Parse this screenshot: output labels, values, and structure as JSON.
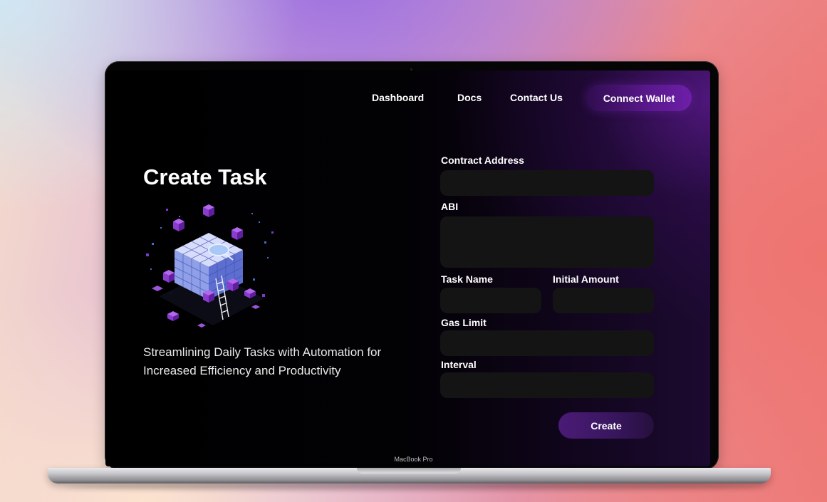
{
  "nav": {
    "dashboard": "Dashboard",
    "docs": "Docs",
    "contact": "Contact Us",
    "connect_wallet": "Connect Wallet"
  },
  "hero": {
    "title": "Create Task",
    "tagline": "Streamlining Daily Tasks with Automation for Increased Efficiency and Productivity"
  },
  "form": {
    "contract_address": {
      "label": "Contract Address",
      "value": ""
    },
    "abi": {
      "label": "ABI",
      "value": ""
    },
    "task_name": {
      "label": "Task Name",
      "value": ""
    },
    "initial_amount": {
      "label": "Initial Amount",
      "value": ""
    },
    "gas_limit": {
      "label": "Gas Limit",
      "value": ""
    },
    "interval": {
      "label": "Interval",
      "value": ""
    },
    "submit_label": "Create"
  },
  "device": {
    "model": "MacBook Pro"
  },
  "colors": {
    "accent": "#5a188d",
    "field_bg": "#141414",
    "screen_bg": "#000000"
  }
}
